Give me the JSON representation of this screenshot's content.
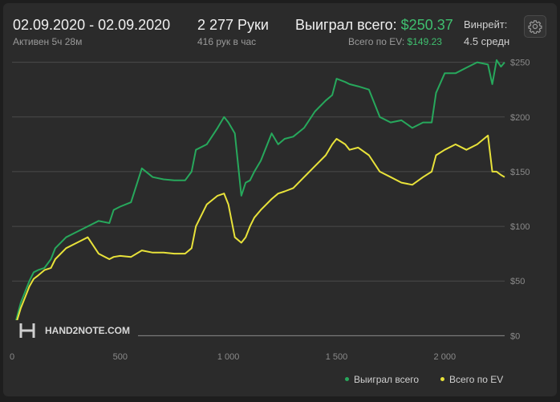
{
  "header": {
    "date_range": "02.09.2020 - 02.09.2020",
    "active_time": "Активен 5ч 28м",
    "hands": "2 277 Руки",
    "hands_per_hour": "416 рук в час",
    "won_total_label": "Выиграл всего:",
    "won_total_value": "$250.37",
    "ev_total_label": "Всего по EV:",
    "ev_total_value": "$149.23",
    "winrate_label": "Винрейт:",
    "winrate_value": "4.5 средн"
  },
  "settings_icon": "gear-icon",
  "brand": {
    "logo_text": "HAND2NOTE.COM"
  },
  "colors": {
    "won": "#27a85c",
    "ev": "#e8e23a",
    "accent": "#3fbf6f"
  },
  "legend": {
    "won_label": "Выиграл всего",
    "ev_label": "Всего по EV"
  },
  "chart_data": {
    "type": "line",
    "xlim": [
      0,
      2277
    ],
    "ylim": [
      -10,
      260
    ],
    "x_ticks": [
      0,
      500,
      1000,
      1500,
      2000
    ],
    "x_tick_labels": [
      "0",
      "500",
      "1 000",
      "1 500",
      "2 000"
    ],
    "y_ticks": [
      0,
      50,
      100,
      150,
      200,
      250
    ],
    "y_tick_labels": [
      "$0",
      "$50",
      "$100",
      "$150",
      "$200",
      "$250"
    ],
    "grid": true,
    "legend_position": "bottom-right",
    "series": [
      {
        "name": "Выиграл всего",
        "x": [
          0,
          20,
          40,
          60,
          80,
          100,
          120,
          150,
          180,
          200,
          250,
          300,
          350,
          400,
          450,
          470,
          500,
          550,
          600,
          650,
          700,
          750,
          800,
          830,
          850,
          900,
          950,
          980,
          1000,
          1030,
          1060,
          1080,
          1100,
          1120,
          1150,
          1200,
          1230,
          1260,
          1300,
          1350,
          1400,
          1450,
          1480,
          1500,
          1540,
          1560,
          1600,
          1650,
          1700,
          1750,
          1800,
          1850,
          1900,
          1940,
          1960,
          2000,
          2050,
          2100,
          2150,
          2200,
          2220,
          2240,
          2260,
          2277
        ],
        "y": [
          0,
          15,
          30,
          40,
          50,
          58,
          60,
          62,
          70,
          80,
          90,
          95,
          100,
          105,
          103,
          115,
          118,
          122,
          153,
          145,
          143,
          142,
          142,
          150,
          170,
          175,
          190,
          200,
          195,
          185,
          128,
          140,
          142,
          150,
          160,
          185,
          175,
          180,
          182,
          190,
          205,
          215,
          220,
          235,
          232,
          230,
          228,
          225,
          200,
          195,
          197,
          190,
          195,
          195,
          222,
          240,
          240,
          245,
          250,
          248,
          230,
          252,
          246,
          250
        ]
      },
      {
        "name": "Всего по EV",
        "x": [
          0,
          20,
          40,
          60,
          80,
          100,
          120,
          150,
          180,
          200,
          250,
          300,
          350,
          400,
          450,
          470,
          500,
          550,
          600,
          650,
          700,
          750,
          800,
          830,
          850,
          900,
          950,
          980,
          1000,
          1030,
          1060,
          1080,
          1100,
          1120,
          1150,
          1200,
          1230,
          1260,
          1300,
          1350,
          1400,
          1450,
          1480,
          1500,
          1540,
          1560,
          1600,
          1650,
          1700,
          1750,
          1800,
          1850,
          1900,
          1940,
          1960,
          2000,
          2050,
          2100,
          2150,
          2200,
          2220,
          2240,
          2260,
          2277
        ],
        "y": [
          0,
          12,
          25,
          35,
          45,
          52,
          55,
          60,
          62,
          70,
          80,
          85,
          90,
          75,
          70,
          72,
          73,
          72,
          78,
          76,
          76,
          75,
          75,
          80,
          100,
          120,
          128,
          130,
          120,
          90,
          85,
          90,
          100,
          108,
          115,
          125,
          130,
          132,
          135,
          145,
          155,
          165,
          175,
          180,
          175,
          170,
          172,
          165,
          150,
          145,
          140,
          138,
          145,
          150,
          165,
          170,
          175,
          170,
          175,
          183,
          150,
          150,
          147,
          145
        ]
      }
    ]
  }
}
